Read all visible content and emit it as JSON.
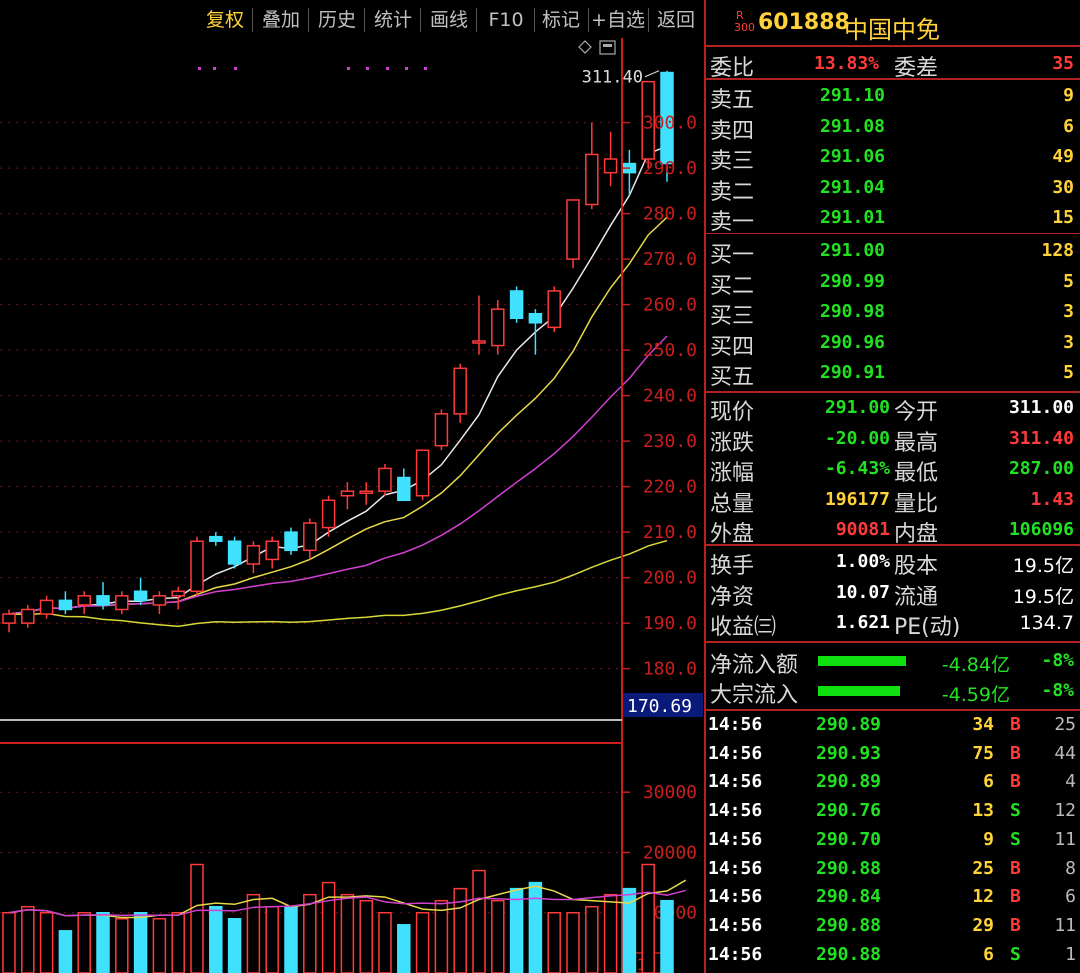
{
  "toolbar": {
    "items": [
      "复权",
      "叠加",
      "历史",
      "统计",
      "画线",
      "F10",
      "标记",
      "+自选",
      "返回"
    ]
  },
  "stock": {
    "code": "601888",
    "name": "中国中免",
    "badge_top": "R",
    "badge_bottom": "300"
  },
  "colors": {
    "up": "#ff3a3a",
    "down": "#40e0ff",
    "text_up": "#ff3a3a",
    "text_down": "#22e022",
    "yellow": "#ffd23a",
    "axis": "#c81e1e"
  },
  "order": {
    "weibi_label": "委比",
    "weibi_value": "13.83%",
    "weicha_label": "委差",
    "weicha_value": "35",
    "asks": [
      {
        "label": "卖五",
        "price": "291.10",
        "vol": "9"
      },
      {
        "label": "卖四",
        "price": "291.08",
        "vol": "6"
      },
      {
        "label": "卖三",
        "price": "291.06",
        "vol": "49"
      },
      {
        "label": "卖二",
        "price": "291.04",
        "vol": "30"
      },
      {
        "label": "卖一",
        "price": "291.01",
        "vol": "15"
      }
    ],
    "bids": [
      {
        "label": "买一",
        "price": "291.00",
        "vol": "128"
      },
      {
        "label": "买二",
        "price": "290.99",
        "vol": "5"
      },
      {
        "label": "买三",
        "price": "290.98",
        "vol": "3"
      },
      {
        "label": "买四",
        "price": "290.96",
        "vol": "3"
      },
      {
        "label": "买五",
        "price": "290.91",
        "vol": "5"
      }
    ]
  },
  "quote": [
    {
      "l1": "现价",
      "v1": "291.00",
      "c1": "down",
      "l2": "今开",
      "v2": "311.00",
      "c2": "white"
    },
    {
      "l1": "涨跌",
      "v1": "-20.00",
      "c1": "down",
      "l2": "最高",
      "v2": "311.40",
      "c2": "up"
    },
    {
      "l1": "涨幅",
      "v1": "-6.43%",
      "c1": "down",
      "l2": "最低",
      "v2": "287.00",
      "c2": "down"
    },
    {
      "l1": "总量",
      "v1": "196177",
      "c1": "yellow",
      "l2": "量比",
      "v2": "1.43",
      "c2": "up"
    },
    {
      "l1": "外盘",
      "v1": "90081",
      "c1": "up",
      "l2": "内盘",
      "v2": "106096",
      "c2": "down"
    }
  ],
  "fundamentals": [
    {
      "l1": "换手",
      "v1": "1.00%",
      "l2": "股本",
      "v2": "19.5亿"
    },
    {
      "l1": "净资",
      "v1": "10.07",
      "l2": "流通",
      "v2": "19.5亿"
    },
    {
      "l1": "收益㈢",
      "v1": "1.621",
      "l2": "PE(动)",
      "v2": "134.7"
    }
  ],
  "flows": [
    {
      "label": "净流入额",
      "value": "-4.84亿",
      "pct": "-8%"
    },
    {
      "label": "大宗流入",
      "value": "-4.59亿",
      "pct": "-8%"
    }
  ],
  "ticks": [
    {
      "time": "14:56",
      "price": "290.89",
      "vol": "34",
      "side": "B",
      "n": "25"
    },
    {
      "time": "14:56",
      "price": "290.93",
      "vol": "75",
      "side": "B",
      "n": "44"
    },
    {
      "time": "14:56",
      "price": "290.89",
      "vol": "6",
      "side": "B",
      "n": "4"
    },
    {
      "time": "14:56",
      "price": "290.76",
      "vol": "13",
      "side": "S",
      "n": "12"
    },
    {
      "time": "14:56",
      "price": "290.70",
      "vol": "9",
      "side": "S",
      "n": "11"
    },
    {
      "time": "14:56",
      "price": "290.88",
      "vol": "25",
      "side": "B",
      "n": "8"
    },
    {
      "time": "14:56",
      "price": "290.84",
      "vol": "12",
      "side": "B",
      "n": "6"
    },
    {
      "time": "14:56",
      "price": "290.88",
      "vol": "29",
      "side": "B",
      "n": "11"
    },
    {
      "time": "14:56",
      "price": "290.88",
      "vol": "6",
      "side": "S",
      "n": "1"
    }
  ],
  "chart_data": {
    "type": "candlestick",
    "price_axis": {
      "ticks": [
        "300.0",
        "290.0",
        "280.0",
        "270.0",
        "260.0",
        "250.0",
        "240.0",
        "230.0",
        "220.0",
        "210.0",
        "200.0",
        "190.0",
        "180.0"
      ],
      "ylim": [
        170.69,
        312
      ],
      "current_marker": "170.69"
    },
    "high_label": "311.40",
    "volume_axis": {
      "ticks": [
        "30000",
        "20000",
        "10000"
      ],
      "unit": "X10",
      "ylim": [
        0,
        38000
      ]
    },
    "candles": [
      {
        "o": 190,
        "h": 193,
        "l": 188,
        "c": 192
      },
      {
        "o": 190,
        "h": 194,
        "l": 189,
        "c": 193
      },
      {
        "o": 192,
        "h": 196,
        "l": 191,
        "c": 195
      },
      {
        "o": 195,
        "h": 197,
        "l": 192,
        "c": 193
      },
      {
        "o": 194,
        "h": 197,
        "l": 192,
        "c": 196
      },
      {
        "o": 196,
        "h": 199,
        "l": 193,
        "c": 194
      },
      {
        "o": 193,
        "h": 197,
        "l": 192,
        "c": 196
      },
      {
        "o": 197,
        "h": 200,
        "l": 194,
        "c": 195
      },
      {
        "o": 194,
        "h": 197,
        "l": 192,
        "c": 196
      },
      {
        "o": 196,
        "h": 198,
        "l": 193,
        "c": 197
      },
      {
        "o": 197,
        "h": 209,
        "l": 196,
        "c": 208
      },
      {
        "o": 209,
        "h": 210,
        "l": 207,
        "c": 208
      },
      {
        "o": 208,
        "h": 209,
        "l": 202,
        "c": 203
      },
      {
        "o": 203,
        "h": 208,
        "l": 201,
        "c": 207
      },
      {
        "o": 204,
        "h": 209,
        "l": 202,
        "c": 208
      },
      {
        "o": 210,
        "h": 211,
        "l": 205,
        "c": 206
      },
      {
        "o": 206,
        "h": 213,
        "l": 204,
        "c": 212
      },
      {
        "o": 211,
        "h": 218,
        "l": 209,
        "c": 217
      },
      {
        "o": 218,
        "h": 221,
        "l": 215,
        "c": 219
      },
      {
        "o": 219,
        "h": 221,
        "l": 216,
        "c": 219
      },
      {
        "o": 219,
        "h": 225,
        "l": 218,
        "c": 224
      },
      {
        "o": 222,
        "h": 224,
        "l": 217,
        "c": 217
      },
      {
        "o": 218,
        "h": 228,
        "l": 217,
        "c": 228
      },
      {
        "o": 229,
        "h": 237,
        "l": 228,
        "c": 236
      },
      {
        "o": 236,
        "h": 247,
        "l": 234,
        "c": 246
      },
      {
        "o": 252,
        "h": 262,
        "l": 249,
        "c": 252
      },
      {
        "o": 251,
        "h": 261,
        "l": 249,
        "c": 259
      },
      {
        "o": 263,
        "h": 264,
        "l": 256,
        "c": 257
      },
      {
        "o": 258,
        "h": 259,
        "l": 249,
        "c": 256
      },
      {
        "o": 255,
        "h": 264,
        "l": 254,
        "c": 263
      },
      {
        "o": 270,
        "h": 283,
        "l": 268,
        "c": 283
      },
      {
        "o": 282,
        "h": 300,
        "l": 281,
        "c": 293
      },
      {
        "o": 289,
        "h": 298,
        "l": 286,
        "c": 292
      },
      {
        "o": 291,
        "h": 294,
        "l": 284,
        "c": 289
      },
      {
        "o": 292,
        "h": 308,
        "l": 290,
        "c": 309
      },
      {
        "o": 311,
        "h": 311.4,
        "l": 287,
        "c": 291
      }
    ],
    "volumes": [
      10,
      11,
      10,
      7,
      10,
      10,
      9,
      10,
      9,
      10,
      18,
      11,
      9,
      13,
      11,
      11,
      13,
      15,
      13,
      12,
      10,
      8,
      10,
      12,
      14,
      17,
      12,
      14,
      15,
      10,
      10,
      11,
      13,
      14,
      18,
      12,
      20
    ]
  }
}
